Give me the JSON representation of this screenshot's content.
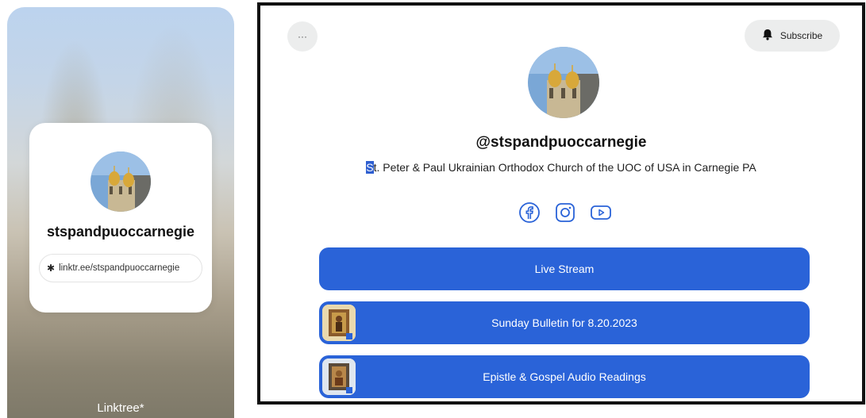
{
  "mobile_preview": {
    "profile_handle": "stspandpuoccarnegie",
    "profile_url": "linktr.ee/stspandpuoccarnegie",
    "linktree_icon": "linktree-icon",
    "footer_brand": "Linktree*"
  },
  "desktop_preview": {
    "more_button_label": "···",
    "subscribe_label": "Subscribe",
    "subscribe_icon": "bell-icon",
    "handle": "@stspandpuoccarnegie",
    "bio_first_letter": "S",
    "bio_rest": "t. Peter & Paul Ukrainian Orthodox Church of the UOC of USA in Carnegie PA",
    "social_icons": [
      "facebook-icon",
      "instagram-icon",
      "youtube-icon"
    ],
    "links": [
      {
        "label": "Live Stream",
        "has_thumbnail": false
      },
      {
        "label": "Sunday Bulletin for 8.20.2023",
        "has_thumbnail": true
      },
      {
        "label": "Epistle & Gospel Audio Readings",
        "has_thumbnail": true
      }
    ]
  },
  "colors": {
    "link_button": "#2a63d8",
    "pill_gray": "#eceded",
    "text_primary": "#111111"
  }
}
